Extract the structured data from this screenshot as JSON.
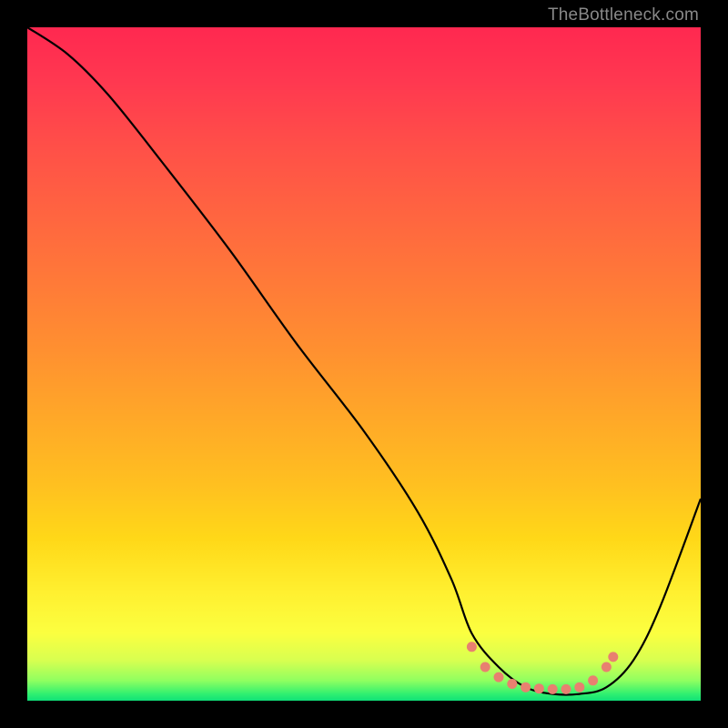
{
  "watermark": "TheBottleneck.com",
  "chart_data": {
    "type": "line",
    "title": "",
    "xlabel": "",
    "ylabel": "",
    "xlim": [
      0,
      100
    ],
    "ylim": [
      0,
      100
    ],
    "series": [
      {
        "name": "bottleneck-curve",
        "x": [
          0,
          6,
          12,
          20,
          30,
          40,
          50,
          58,
          63,
          66,
          70,
          74,
          78,
          82,
          86,
          90,
          94,
          100
        ],
        "y": [
          100,
          96,
          90,
          80,
          67,
          53,
          40,
          28,
          18,
          10,
          5,
          2,
          1,
          1,
          2,
          6,
          14,
          30
        ]
      }
    ],
    "markers": {
      "name": "highlighted-range",
      "color": "#e88070",
      "points": [
        {
          "x": 66,
          "y": 8
        },
        {
          "x": 68,
          "y": 5
        },
        {
          "x": 70,
          "y": 3.5
        },
        {
          "x": 72,
          "y": 2.5
        },
        {
          "x": 74,
          "y": 2
        },
        {
          "x": 76,
          "y": 1.8
        },
        {
          "x": 78,
          "y": 1.7
        },
        {
          "x": 80,
          "y": 1.7
        },
        {
          "x": 82,
          "y": 2
        },
        {
          "x": 84,
          "y": 3
        },
        {
          "x": 86,
          "y": 5
        },
        {
          "x": 87,
          "y": 6.5
        }
      ]
    }
  }
}
